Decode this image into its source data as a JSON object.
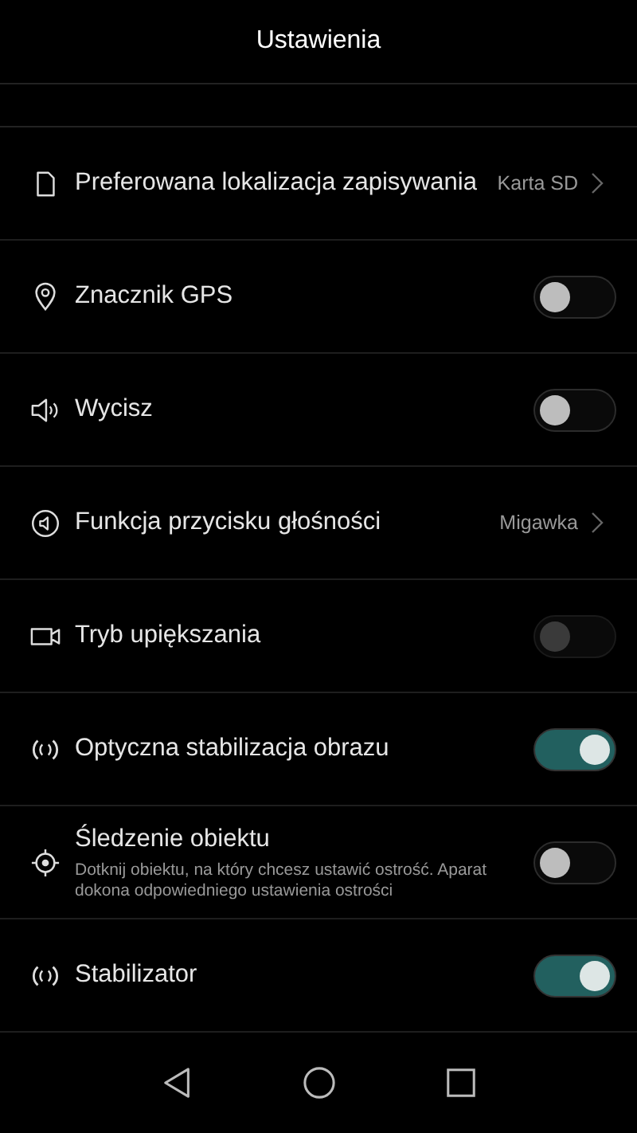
{
  "header": {
    "title": "Ustawienia"
  },
  "settings": [
    {
      "kind": "link",
      "label": "Preferowana lokalizacja zapisywania",
      "value": "Karta SD"
    },
    {
      "kind": "toggle",
      "label": "Znacznik GPS",
      "on": false,
      "disabled": false
    },
    {
      "kind": "toggle",
      "label": "Wycisz",
      "on": false,
      "disabled": false
    },
    {
      "kind": "link",
      "label": "Funkcja przycisku głośności",
      "value": "Migawka"
    },
    {
      "kind": "toggle",
      "label": "Tryb upiększania",
      "on": false,
      "disabled": true
    },
    {
      "kind": "toggle",
      "label": "Optyczna stabilizacja obrazu",
      "on": true,
      "disabled": false
    },
    {
      "kind": "toggle",
      "label": "Śledzenie obiektu",
      "description": "Dotknij obiektu, na który chcesz ustawić ostrość. Aparat dokona odpowiedniego ustawienia ostrości",
      "on": false,
      "disabled": false
    },
    {
      "kind": "toggle",
      "label": "Stabilizator",
      "on": true,
      "disabled": false
    }
  ]
}
